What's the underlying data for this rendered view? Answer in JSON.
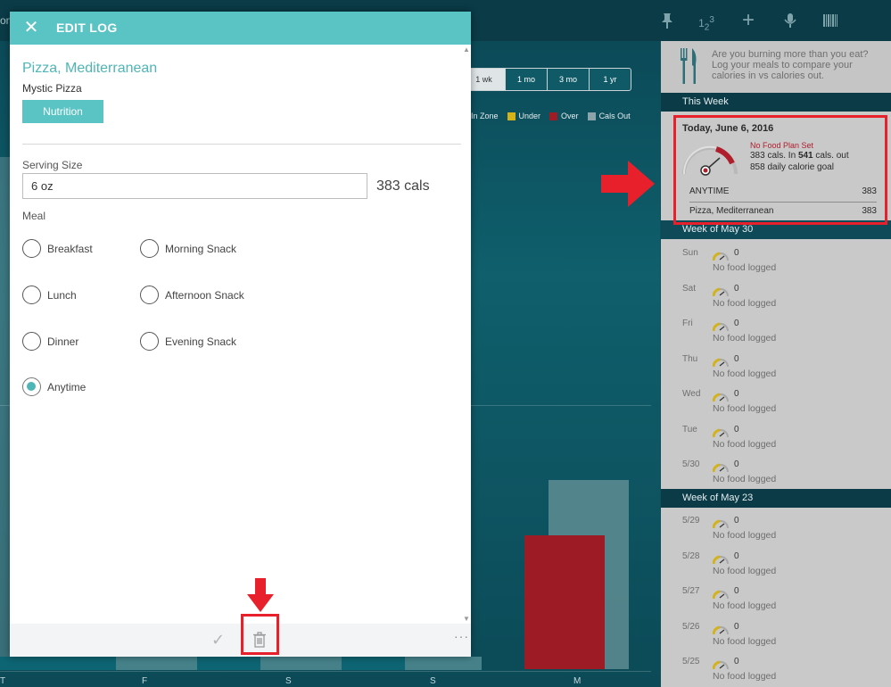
{
  "background": {
    "cut_text": "on",
    "range_tabs": [
      "1 wk",
      "1 mo",
      "3 mo",
      "1 yr"
    ],
    "active_range": "1 wk",
    "legend": [
      {
        "label": "In Zone",
        "color": "#ffffff"
      },
      {
        "label": "Under",
        "color": "#d4b21a"
      },
      {
        "label": "Over",
        "color": "#a01c25"
      },
      {
        "label": "Cals Out",
        "color": "#8aa4aa"
      }
    ],
    "day_labels": [
      "T",
      "F",
      "S",
      "S",
      "M"
    ],
    "toolbar_icons": [
      "pin-icon",
      "number-keypad-icon",
      "add-icon",
      "microphone-icon",
      "barcode-icon"
    ]
  },
  "modal": {
    "title": "EDIT LOG",
    "close_glyph": "✕",
    "food_name": "Pizza, Mediterranean",
    "brand": "Mystic Pizza",
    "nutrition_label": "Nutrition",
    "serving_label": "Serving Size",
    "serving_value": "6 oz",
    "calories": "383 cals",
    "meal_label": "Meal",
    "meals": [
      {
        "label": "Breakfast",
        "checked": false
      },
      {
        "label": "Morning Snack",
        "checked": false
      },
      {
        "label": "Lunch",
        "checked": false
      },
      {
        "label": "Afternoon Snack",
        "checked": false
      },
      {
        "label": "Dinner",
        "checked": false
      },
      {
        "label": "Evening Snack",
        "checked": false
      },
      {
        "label": "Anytime",
        "checked": true
      }
    ],
    "footer": {
      "confirm_glyph": "✓",
      "more_glyph": "···"
    }
  },
  "side_panel": {
    "promo_text": "Are you burning more than you eat? Log your meals to compare your calories in vs calories out.",
    "this_week_label": "This Week",
    "today": {
      "title": "Today, June 6, 2016",
      "plan_status": "No Food Plan Set",
      "cals_in": "383",
      "cals_in_text": " cals. In ",
      "cals_out": "541",
      "cals_out_text": " cals. out",
      "goal_text": "858 daily calorie goal",
      "rows": [
        {
          "label": "ANYTIME",
          "value": "383"
        },
        {
          "label": "Pizza, Mediterranean",
          "value": "383"
        }
      ]
    },
    "weeks": [
      {
        "label": "Week of May 30",
        "days": [
          {
            "day": "Sun",
            "count": "0",
            "status": "No food logged"
          },
          {
            "day": "Sat",
            "count": "0",
            "status": "No food logged"
          },
          {
            "day": "Fri",
            "count": "0",
            "status": "No food logged"
          },
          {
            "day": "Thu",
            "count": "0",
            "status": "No food logged"
          },
          {
            "day": "Wed",
            "count": "0",
            "status": "No food logged"
          },
          {
            "day": "Tue",
            "count": "0",
            "status": "No food logged"
          },
          {
            "day": "5/30",
            "count": "0",
            "status": "No food logged"
          }
        ]
      },
      {
        "label": "Week of May 23",
        "days": [
          {
            "day": "5/29",
            "count": "0",
            "status": "No food logged"
          },
          {
            "day": "5/28",
            "count": "0",
            "status": "No food logged"
          },
          {
            "day": "5/27",
            "count": "0",
            "status": "No food logged"
          },
          {
            "day": "5/26",
            "count": "0",
            "status": "No food logged"
          },
          {
            "day": "5/25",
            "count": "0",
            "status": "No food logged"
          }
        ]
      }
    ]
  },
  "colors": {
    "accent": "#5ac3c4",
    "dark_teal": "#0a3b47",
    "annotation_red": "#e8202b",
    "over_red": "#a01c25",
    "under_yellow": "#d4b21a"
  }
}
